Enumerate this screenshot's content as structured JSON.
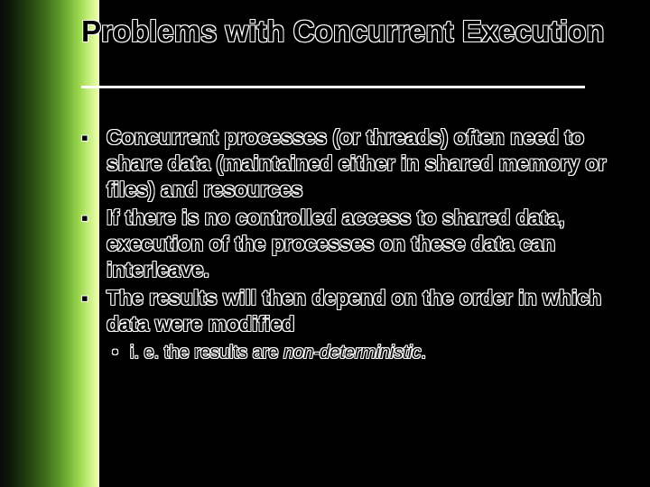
{
  "title": "Problems with Concurrent Execution",
  "bullets": [
    "Concurrent processes (or threads) often need to share data (maintained either in shared memory or files) and resources",
    "If there is no controlled access to shared data, execution of the processes on these data can interleave.",
    "The results will then depend on the order in which data were modified"
  ],
  "sub_prefix": "i. e. the results are ",
  "sub_emph": "non-deterministic",
  "sub_suffix": "."
}
